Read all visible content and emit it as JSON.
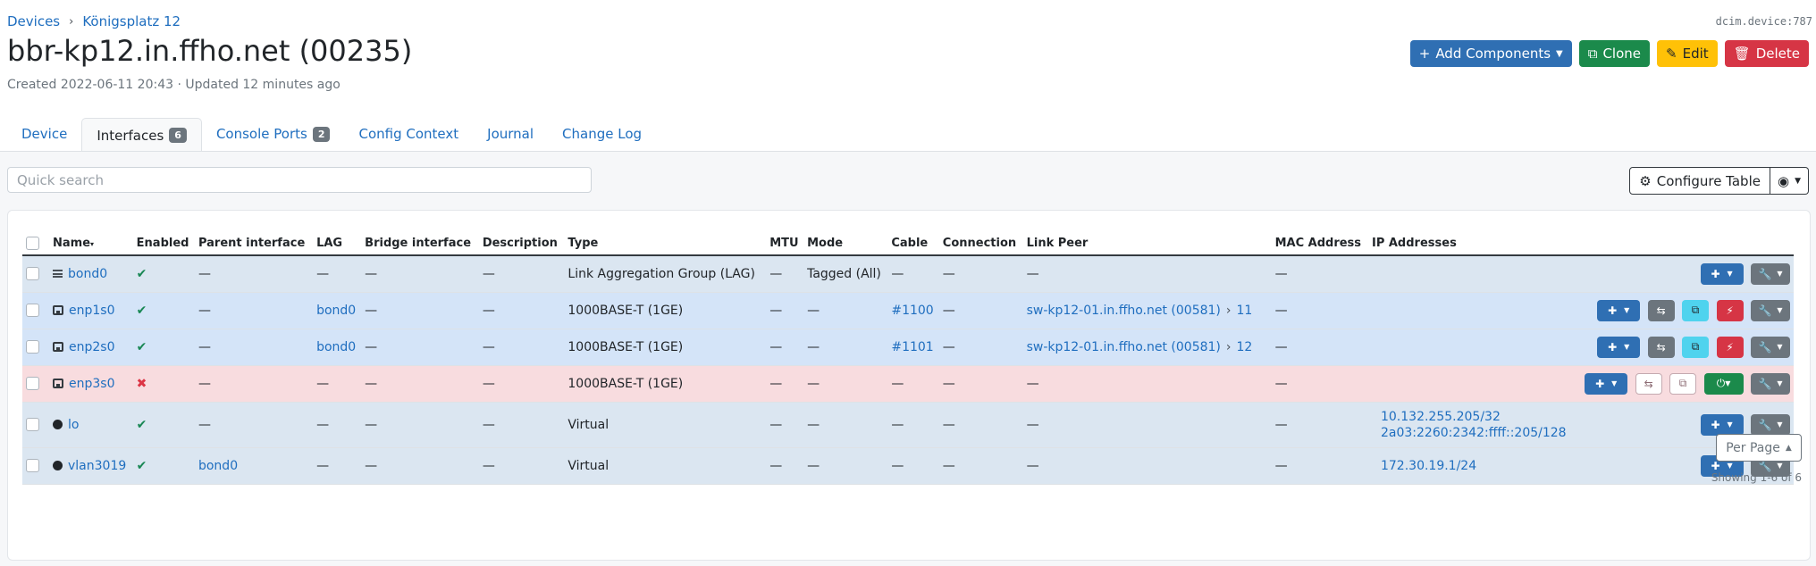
{
  "breadcrumb": {
    "items": [
      "Devices",
      "Königsplatz 12"
    ]
  },
  "object_id": "dcim.device:787",
  "title": "bbr-kp12.in.ffho.net (00235)",
  "meta": "Created 2022-06-11 20:43 · Updated 12 minutes ago",
  "actions": {
    "add_components": "Add Components",
    "clone": "Clone",
    "edit": "Edit",
    "delete": "Delete"
  },
  "tabs": [
    {
      "label": "Device"
    },
    {
      "label": "Interfaces",
      "badge": "6"
    },
    {
      "label": "Console Ports",
      "badge": "2"
    },
    {
      "label": "Config Context"
    },
    {
      "label": "Journal"
    },
    {
      "label": "Change Log"
    }
  ],
  "search": {
    "placeholder": "Quick search"
  },
  "configure_table": "Configure Table",
  "table": {
    "columns": [
      "Name",
      "Enabled",
      "Parent interface",
      "LAG",
      "Bridge interface",
      "Description",
      "Type",
      "MTU",
      "Mode",
      "Cable",
      "Connection",
      "Link Peer",
      "MAC Address",
      "IP Addresses"
    ],
    "rows": [
      {
        "icon": "lag-icon",
        "name": "bond0",
        "enabled": "✔",
        "parent": "—",
        "lag": "—",
        "bridge": "—",
        "description": "—",
        "type": "Link Aggregation Group (LAG)",
        "mtu": "—",
        "mode": "Tagged (All)",
        "cable": "—",
        "connection": "—",
        "peer_device": "—",
        "peer_port": "",
        "mac": "—",
        "ip1": "",
        "ip2": ""
      },
      {
        "icon": "ethernet-port-icon",
        "name": "enp1s0",
        "enabled": "✔",
        "parent": "—",
        "lag": "bond0",
        "bridge": "—",
        "description": "—",
        "type": "1000BASE-T (1GE)",
        "mtu": "—",
        "mode": "—",
        "cable": "#1100",
        "connection": "—",
        "peer_device": "sw-kp12-01.in.ffho.net (00581)",
        "peer_port": "11",
        "mac": "—",
        "ip1": "",
        "ip2": ""
      },
      {
        "icon": "ethernet-port-icon",
        "name": "enp2s0",
        "enabled": "✔",
        "parent": "—",
        "lag": "bond0",
        "bridge": "—",
        "description": "—",
        "type": "1000BASE-T (1GE)",
        "mtu": "—",
        "mode": "—",
        "cable": "#1101",
        "connection": "—",
        "peer_device": "sw-kp12-01.in.ffho.net (00581)",
        "peer_port": "12",
        "mac": "—",
        "ip1": "",
        "ip2": ""
      },
      {
        "icon": "ethernet-port-icon",
        "name": "enp3s0",
        "enabled": "✖",
        "parent": "—",
        "lag": "—",
        "bridge": "—",
        "description": "—",
        "type": "1000BASE-T (1GE)",
        "mtu": "—",
        "mode": "—",
        "cable": "—",
        "connection": "—",
        "peer_device": "—",
        "peer_port": "",
        "mac": "—",
        "ip1": "",
        "ip2": ""
      },
      {
        "icon": "virtual-dot-icon",
        "name": "lo",
        "enabled": "✔",
        "parent": "—",
        "lag": "—",
        "bridge": "—",
        "description": "—",
        "type": "Virtual",
        "mtu": "—",
        "mode": "—",
        "cable": "—",
        "connection": "—",
        "peer_device": "—",
        "peer_port": "",
        "mac": "—",
        "ip1": "10.132.255.205/32",
        "ip2": "2a03:2260:2342:ffff::205/128"
      },
      {
        "icon": "virtual-dot-icon",
        "name": "vlan3019",
        "enabled": "✔",
        "parent": "bond0",
        "lag": "—",
        "bridge": "—",
        "description": "—",
        "type": "Virtual",
        "mtu": "—",
        "mode": "—",
        "cable": "—",
        "connection": "—",
        "peer_device": "—",
        "peer_port": "",
        "mac": "—",
        "ip1": "172.30.19.1/24",
        "ip2": ""
      }
    ]
  },
  "pagination": {
    "per_page": "Per Page",
    "showing": "Showing 1-6 of 6"
  },
  "colors": {
    "primary": "#2f6fb3",
    "success": "#1b8a4b",
    "warning": "#ffc107",
    "danger": "#d63545",
    "row_enabled": "#dbe6f1",
    "row_connected": "#d4e4f8",
    "row_disabled": "#f8dcdf"
  }
}
